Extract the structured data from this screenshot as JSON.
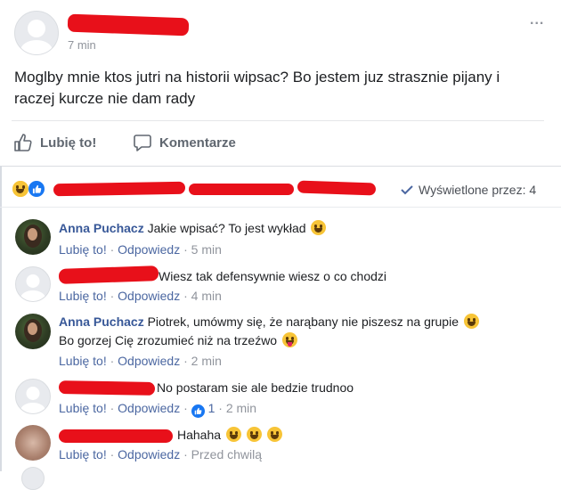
{
  "post": {
    "time": "7 min",
    "text": "Moglby mnie ktos jutri na historii wipsac? Bo jestem juz strasznie pijany i raczej kurcze nie dam rady",
    "more": "..."
  },
  "actions": {
    "like": "Lubię to!",
    "comment": "Komentarze"
  },
  "reactions": {
    "seen": "Wyświetlone przez: 4"
  },
  "comments": [
    {
      "author": "Anna Puchacz",
      "text": "Jakie wpisać? To jest wykład",
      "like": "Lubię to!",
      "reply": "Odpowiedz",
      "time": "5 min"
    },
    {
      "author": "",
      "text": "Wiesz tak defensywnie wiesz o co chodzi",
      "like": "Lubię to!",
      "reply": "Odpowiedz",
      "time": "4 min"
    },
    {
      "author": "Anna Puchacz",
      "text": "Piotrek, umówmy się, że narąbany nie piszesz na grupie",
      "text2": "Bo gorzej Cię zrozumieć niż na trzeźwo",
      "like": "Lubię to!",
      "reply": "Odpowiedz",
      "time": "2 min"
    },
    {
      "author": "",
      "text": "No postaram sie ale bedzie trudnoo",
      "like": "Lubię to!",
      "reply": "Odpowiedz",
      "reactions": "1",
      "time": "2 min"
    },
    {
      "author": "",
      "text": "Hahaha",
      "like": "Lubię to!",
      "reply": "Odpowiedz",
      "time": "Przed chwilą"
    }
  ],
  "separator": "·",
  "colors": {
    "link": "#385898",
    "meta": "#90949c",
    "redaction": "#e8101a",
    "like_blue": "#1877f2"
  }
}
